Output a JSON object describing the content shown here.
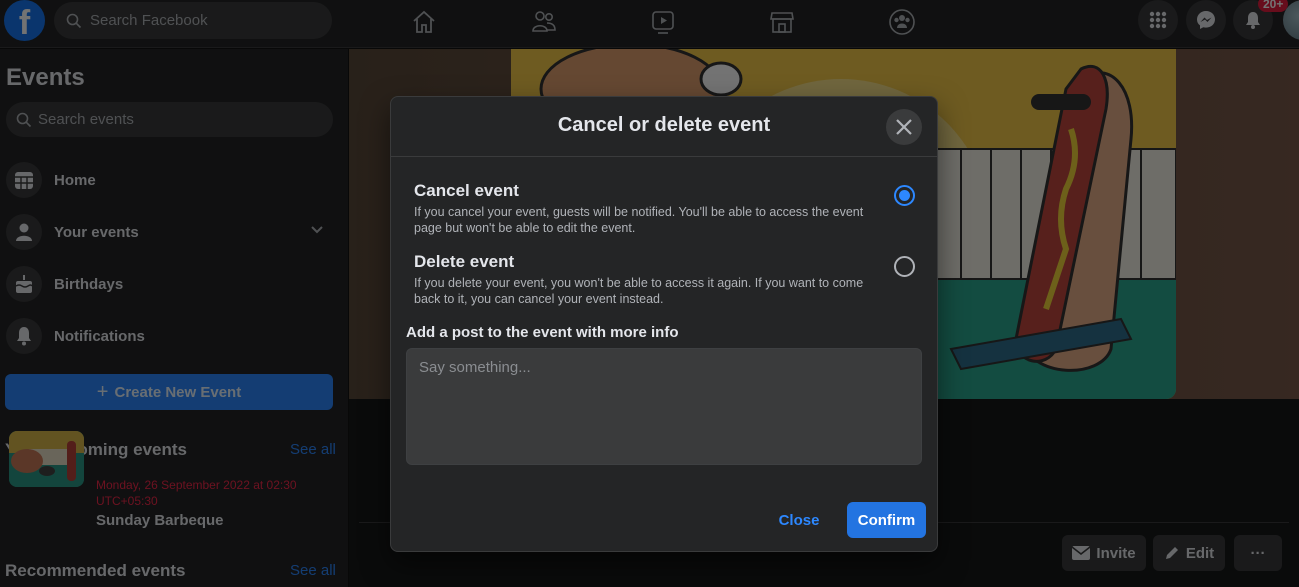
{
  "topbar": {
    "logo": "f",
    "search_placeholder": "Search Facebook",
    "nav_icons": [
      "home-icon",
      "friends-icon",
      "watch-icon",
      "marketplace-icon",
      "groups-icon"
    ],
    "right_icons": [
      "menu-grid-icon",
      "messenger-icon",
      "notifications-bell-icon"
    ],
    "notification_badge": "20+"
  },
  "sidebar": {
    "title": "Events",
    "search_placeholder": "Search events",
    "items": [
      {
        "label": "Home",
        "icon": "calendar-icon"
      },
      {
        "label": "Your events",
        "icon": "person-icon",
        "expandable": true
      },
      {
        "label": "Birthdays",
        "icon": "cake-icon"
      },
      {
        "label": "Notifications",
        "icon": "bell-icon"
      }
    ],
    "create_button": "Create New Event",
    "upcoming_title": "Your upcoming events",
    "see_all": "See all",
    "upcoming_event": {
      "date": "Monday, 26 September 2022 at 02:30 UTC+05:30",
      "name": "Sunday Barbeque"
    },
    "recommended_title": "Recommended events"
  },
  "main": {
    "actions": {
      "invite": "Invite",
      "edit": "Edit",
      "more": "···"
    }
  },
  "dialog": {
    "title": "Cancel or delete event",
    "options": [
      {
        "title": "Cancel event",
        "description": "If you cancel your event, guests will be notified. You'll be able to access the event page but won't be able to edit the event.",
        "selected": true
      },
      {
        "title": "Delete event",
        "description": "If you delete your event, you won't be able to access it again. If you want to come back to it, you can cancel your event instead.",
        "selected": false
      }
    ],
    "post_label": "Add a post to the event with more info",
    "post_placeholder": "Say something...",
    "post_value": "",
    "close_label": "Close",
    "confirm_label": "Confirm"
  },
  "colors": {
    "accent": "#2d88ff",
    "confirm_button": "#2374e1",
    "dialog_bg": "#242526",
    "date_text": "#f02849",
    "badge": "#e41e3f"
  }
}
